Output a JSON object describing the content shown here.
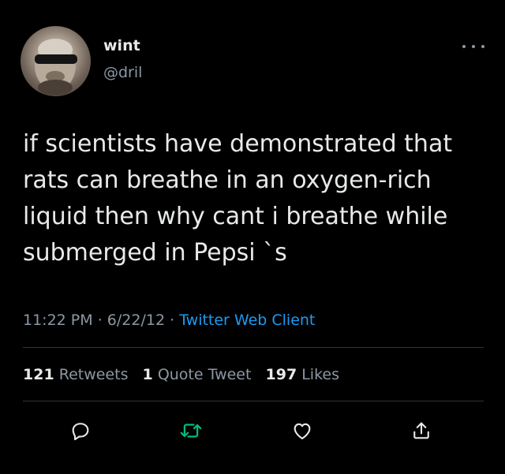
{
  "tweet": {
    "display_name": "wint",
    "handle": "@dril",
    "text": "if scientists have demonstrated that\nrats can breathe in an oxygen-rich\nliquid then why cant i breathe while\nsubmerged in Pepsi `s",
    "time": "11:22 PM",
    "date": "6/22/12",
    "client": "Twitter Web Client",
    "separator": "·",
    "stats": {
      "retweets_count": "121",
      "retweets_label": "Retweets",
      "quotes_count": "1",
      "quotes_label": "Quote Tweet",
      "likes_count": "197",
      "likes_label": "Likes"
    }
  },
  "icons": {
    "more": "more-icon",
    "reply": "reply-icon",
    "retweet": "retweet-icon",
    "like": "like-icon",
    "share": "share-icon"
  },
  "colors": {
    "background": "#000000",
    "text": "#e7e9ea",
    "secondary": "#8b98a5",
    "link": "#1d9bf0",
    "retweet": "#00ba7c",
    "divider": "#2f3336"
  }
}
